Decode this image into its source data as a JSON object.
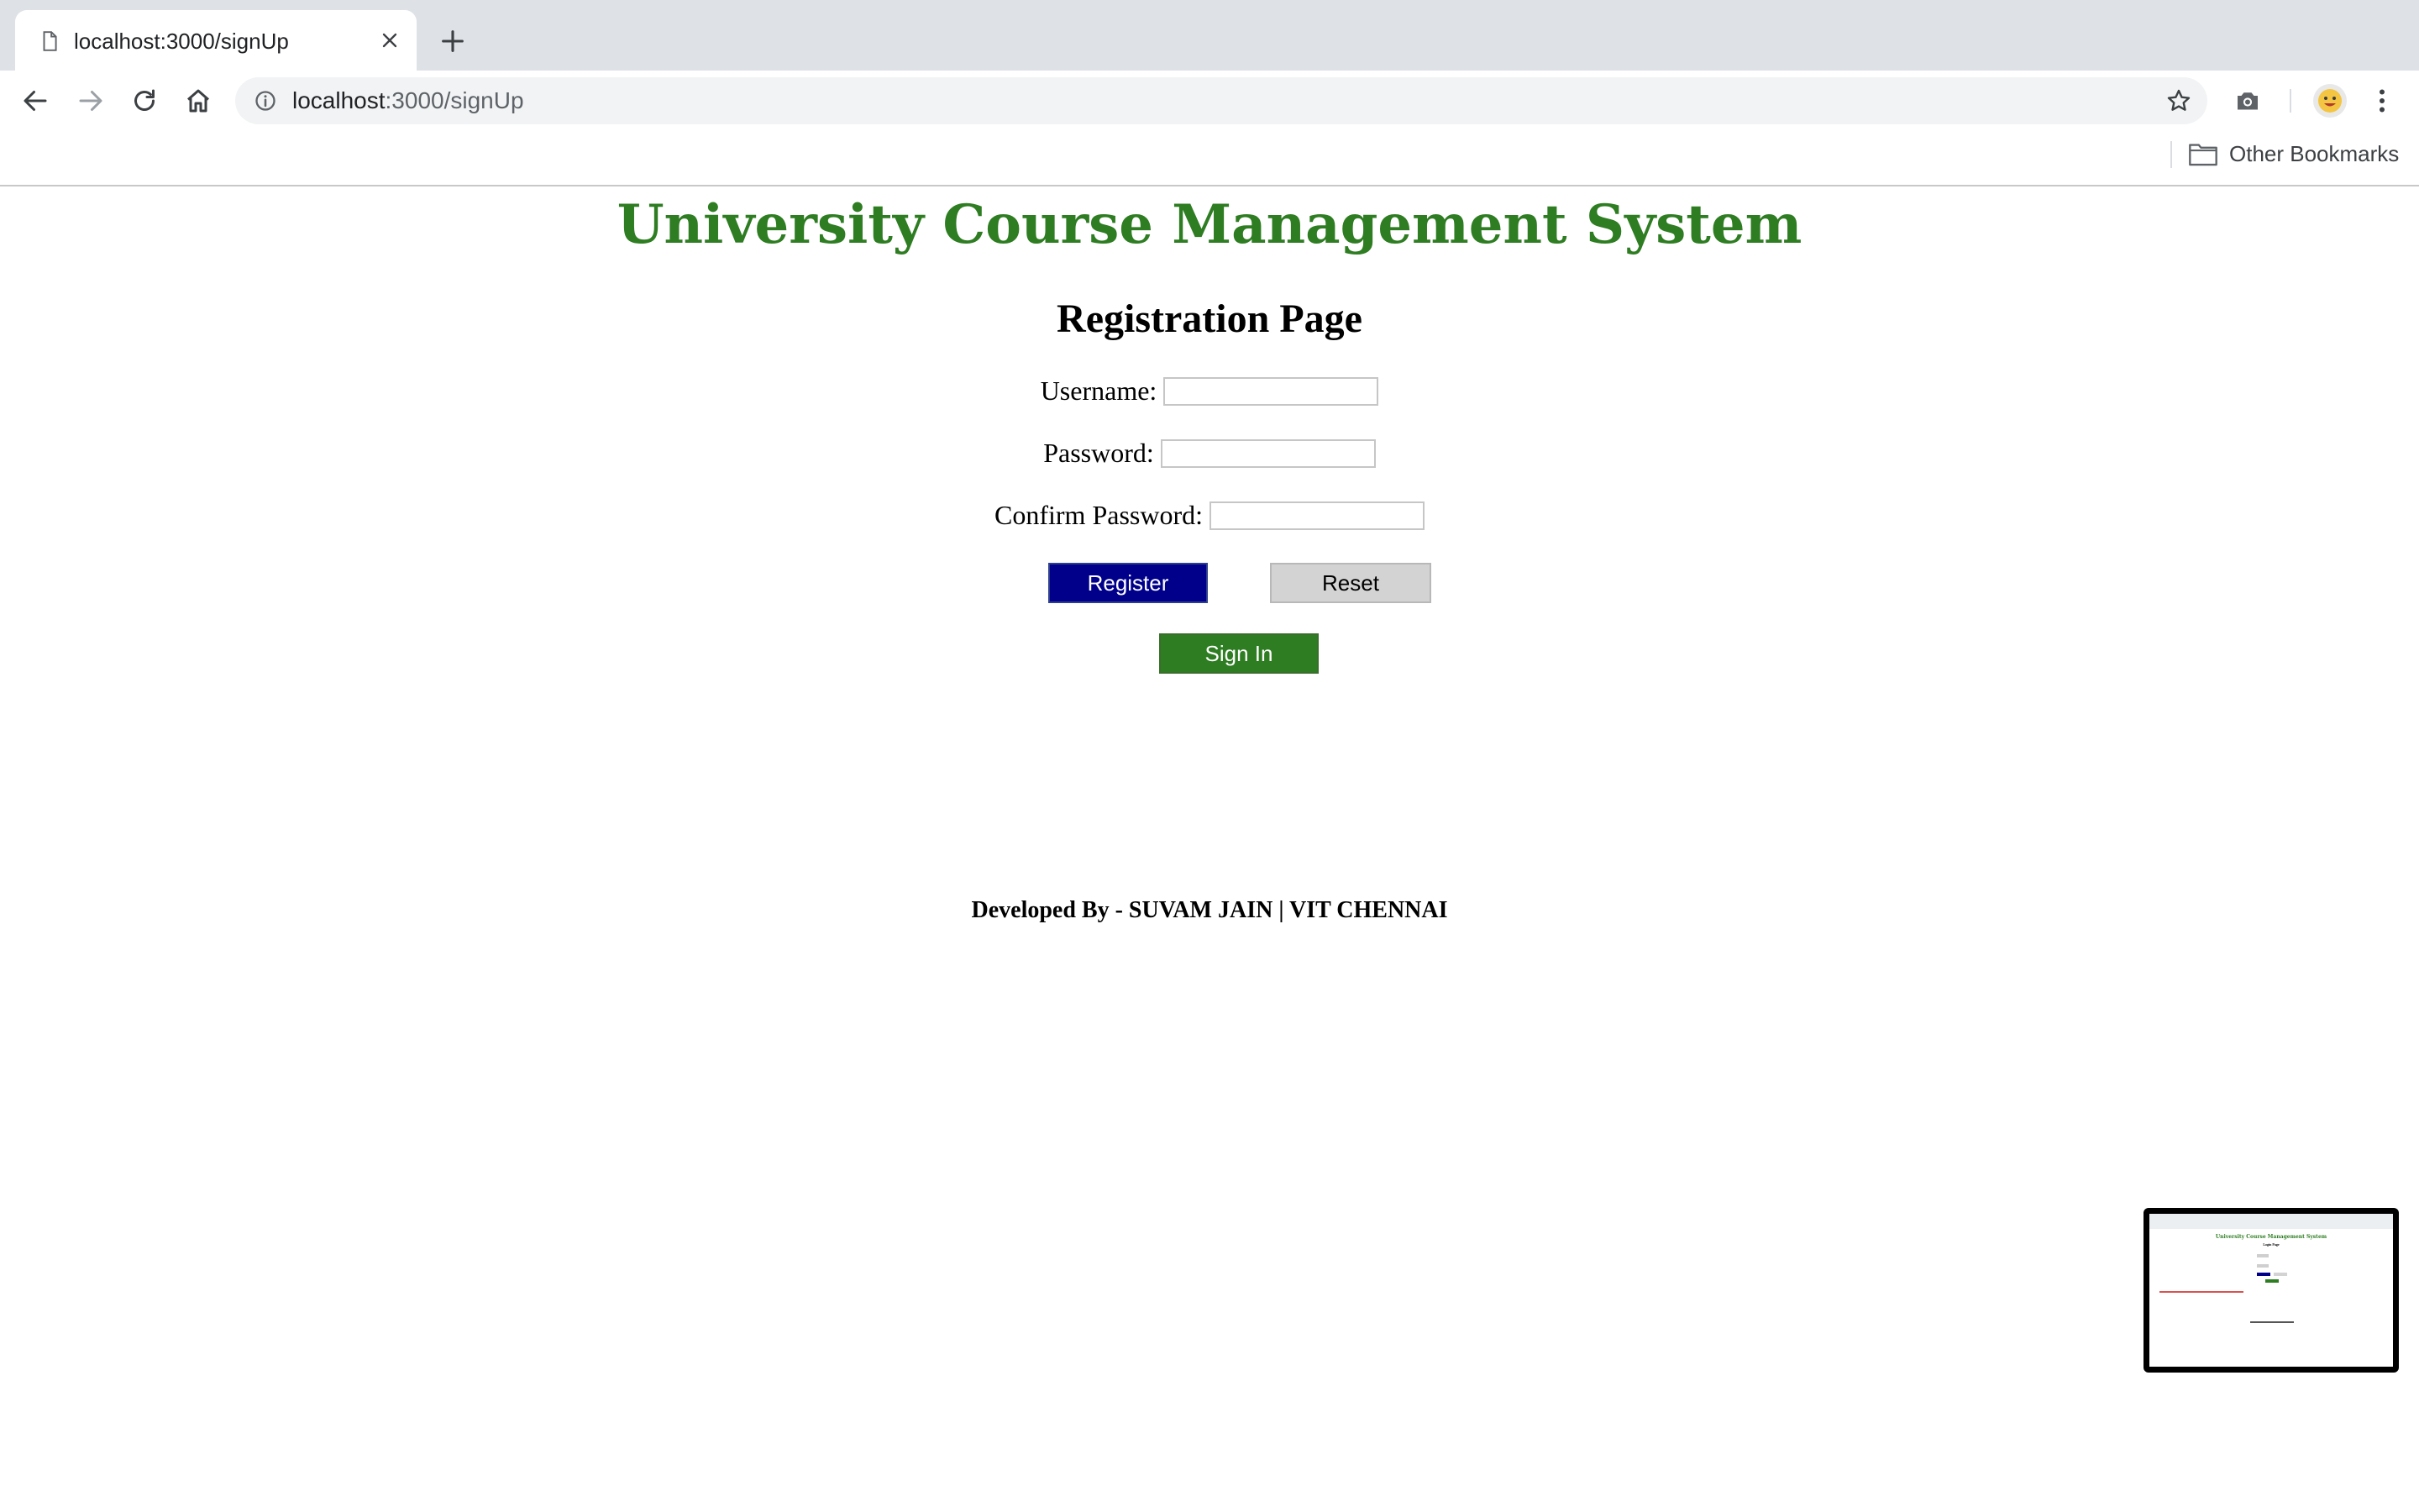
{
  "browser": {
    "tab_title": "localhost:3000/signUp",
    "address_host": "localhost",
    "address_path": ":3000/signUp",
    "bookmarks": {
      "other_label": "Other Bookmarks"
    }
  },
  "page": {
    "site_title": "University Course Management System",
    "heading": "Registration Page",
    "form": {
      "username_label": "Username:",
      "username_value": "",
      "password_label": "Password:",
      "password_value": "",
      "confirm_label": "Confirm Password:",
      "confirm_value": ""
    },
    "buttons": {
      "register": "Register",
      "reset": "Reset",
      "signin": "Sign In"
    },
    "footer": "Developed By - SUVAM JAIN | VIT CHENNAI"
  },
  "thumbnail": {
    "title": "University Course Management System",
    "heading": "Login Page"
  },
  "colors": {
    "title_green": "#2e7d22",
    "register_blue": "#00008b",
    "reset_gray": "#d3d3d3"
  },
  "icons": [
    "page-icon",
    "close-icon",
    "plus-icon",
    "back-icon",
    "forward-icon",
    "reload-icon",
    "home-icon",
    "info-icon",
    "star-icon",
    "camera-icon",
    "profile-avatar",
    "more-icon",
    "folder-icon"
  ]
}
